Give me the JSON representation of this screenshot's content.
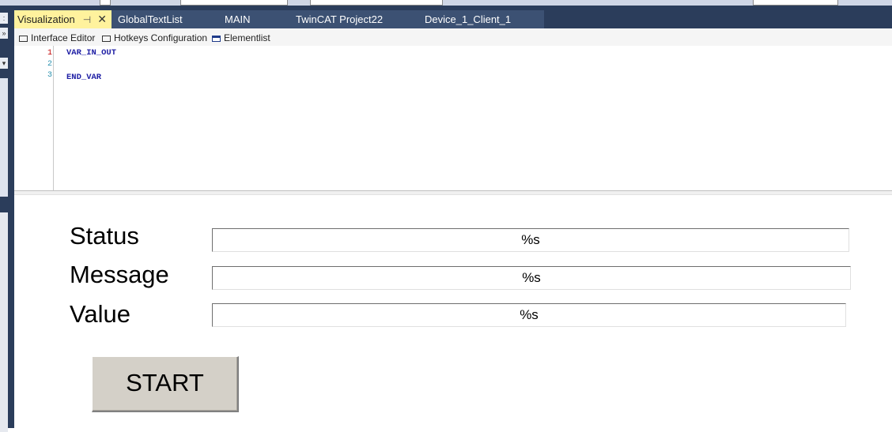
{
  "tabs": [
    {
      "label": "Visualization",
      "active": true
    },
    {
      "label": "GlobalTextList",
      "active": false
    },
    {
      "label": "MAIN",
      "active": false
    },
    {
      "label": "TwinCAT Project22",
      "active": false
    },
    {
      "label": "Device_1_Client_1",
      "active": false
    }
  ],
  "subtoolbar": {
    "interface_editor": "Interface Editor",
    "hotkeys_configuration": "Hotkeys Configuration",
    "elementlist": "Elementlist"
  },
  "editor": {
    "line_numbers": [
      "1",
      "2",
      "3"
    ],
    "lines": [
      "VAR_IN_OUT",
      "",
      "END_VAR"
    ]
  },
  "visualization": {
    "fields": [
      {
        "label": "Status",
        "value": "%s"
      },
      {
        "label": "Message",
        "value": "%s"
      },
      {
        "label": "Value",
        "value": "%s"
      }
    ],
    "start_button": "START"
  },
  "colors": {
    "active_tab": "#fff29d",
    "tab_bar": "#2b3d5b",
    "code_keyword": "#1f1fa5",
    "button_face": "#d4d0c8"
  },
  "icons": [
    "pin-icon",
    "close-icon",
    "interface-editor-icon",
    "hotkeys-icon",
    "elementlist-icon"
  ]
}
